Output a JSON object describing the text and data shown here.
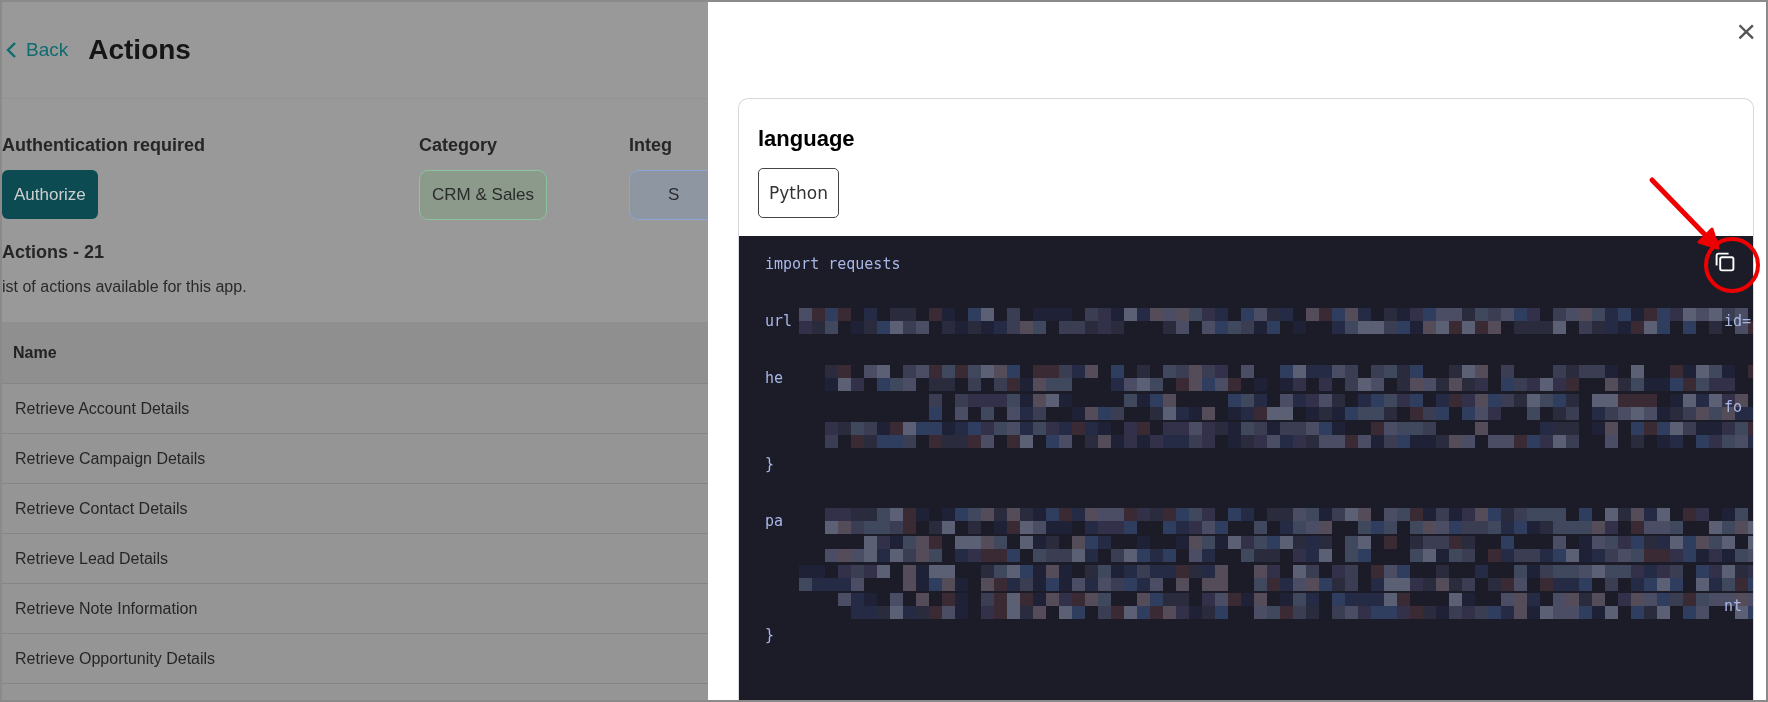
{
  "page": {
    "back_link": "Back",
    "title": "Actions",
    "auth": {
      "heading": "Authentication required",
      "button": "Authorize"
    },
    "category": {
      "heading": "Category",
      "chip": "CRM & Sales"
    },
    "integration": {
      "heading": "Integ",
      "chip": "S"
    },
    "actions_heading": "Actions - 21",
    "actions_description": "ist of actions available for this app.",
    "table": {
      "columns": [
        "Name"
      ],
      "rows": [
        {
          "name": "Retrieve Account Details"
        },
        {
          "name": "Retrieve Campaign Details"
        },
        {
          "name": "Retrieve Contact Details"
        },
        {
          "name": "Retrieve Lead Details"
        },
        {
          "name": "Retrieve Note Information"
        },
        {
          "name": "Retrieve Opportunity Details"
        }
      ]
    }
  },
  "drawer": {
    "close": "×",
    "card": {
      "heading": "language",
      "language_chip": "Python",
      "code_block": {
        "lines": [
          {
            "kind": "code",
            "text": "import requests"
          },
          {
            "kind": "blank"
          },
          {
            "kind": "code",
            "text": "url",
            "tail": "id=",
            "redacted": true
          },
          {
            "kind": "blank"
          },
          {
            "kind": "code",
            "text": "he",
            "redacted": true
          },
          {
            "kind": "code",
            "tail": "fo",
            "redacted": true
          },
          {
            "kind": "code",
            "redacted": true
          },
          {
            "kind": "code",
            "text": "}"
          },
          {
            "kind": "blank"
          },
          {
            "kind": "code",
            "text": "pa",
            "redacted": true
          },
          {
            "kind": "code",
            "redacted": true
          },
          {
            "kind": "code",
            "redacted": true
          },
          {
            "kind": "code",
            "tail": "nt",
            "redacted": true
          },
          {
            "kind": "code",
            "text": "}"
          }
        ]
      }
    }
  }
}
